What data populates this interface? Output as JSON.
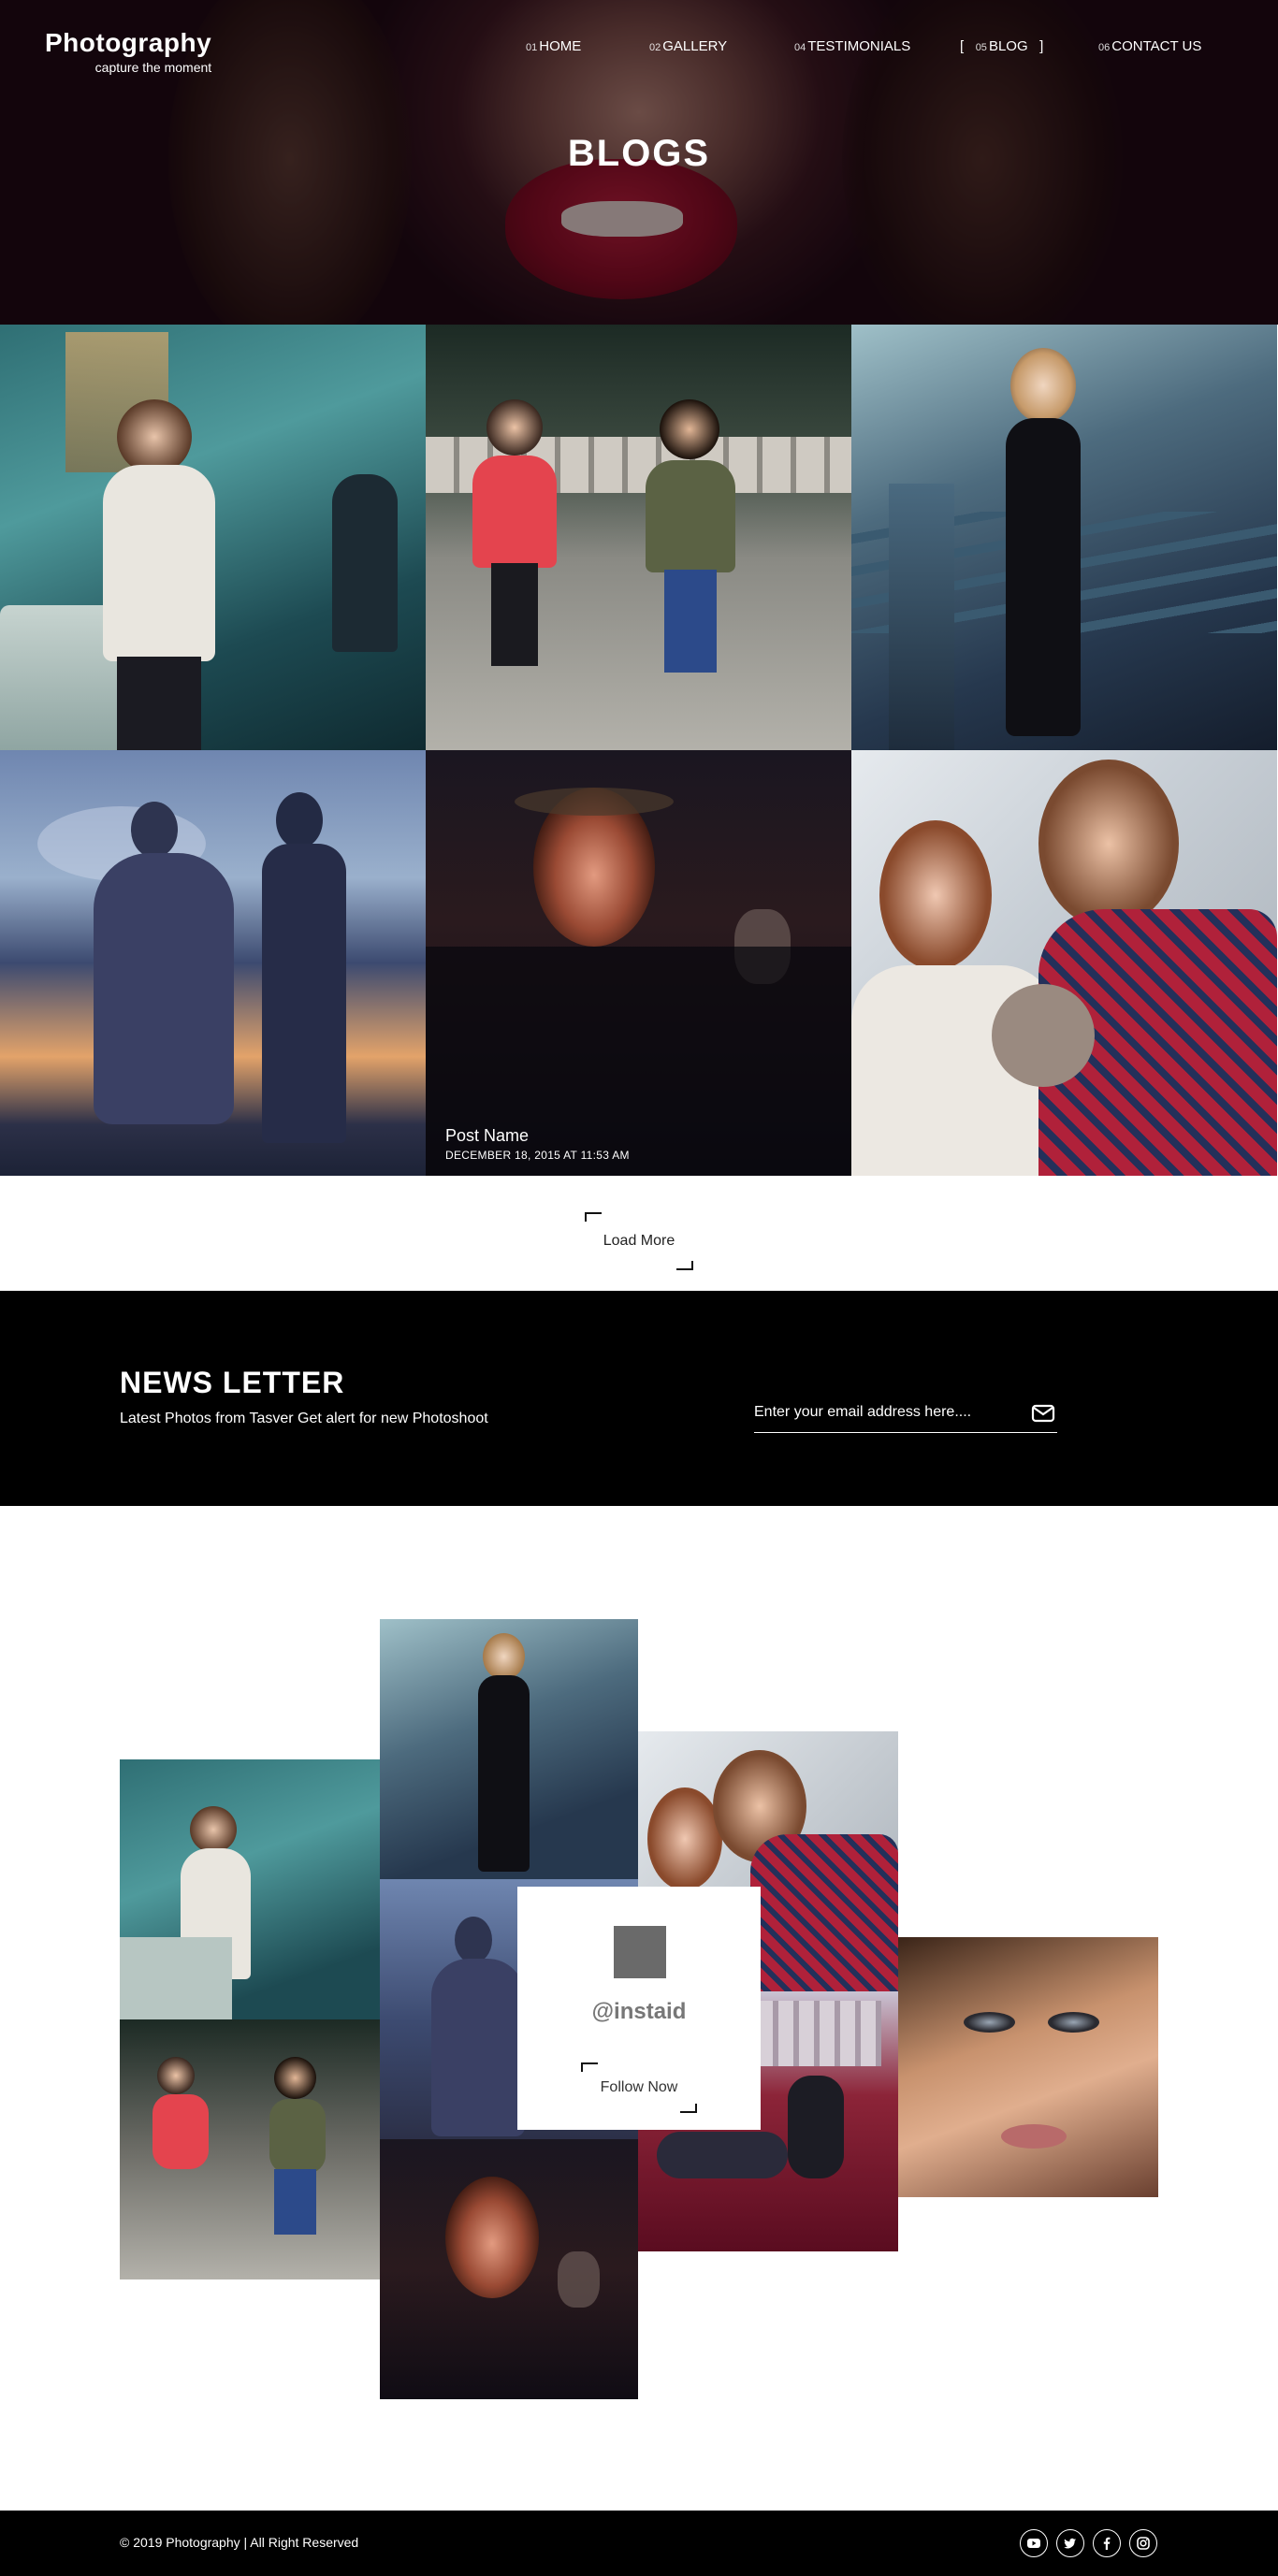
{
  "brand": {
    "title": "Photography",
    "tagline": "capture the moment"
  },
  "nav": [
    {
      "num": "01",
      "label": "HOME",
      "active": false
    },
    {
      "num": "02",
      "label": "GALLERY",
      "active": false
    },
    {
      "num": "04",
      "label": "TESTIMONIALS",
      "active": false
    },
    {
      "num": "05",
      "label": "BLOG",
      "active": true
    },
    {
      "num": "06",
      "label": "CONTACT US",
      "active": false
    }
  ],
  "nav_active_brackets": {
    "open": "[",
    "close": "]"
  },
  "hero": {
    "title": "BLOGS"
  },
  "gallery": {
    "post": {
      "name": "Post Name",
      "date": "DECEMBER 18, 2015 AT 11:53 AM"
    },
    "load_more": "Load More"
  },
  "newsletter": {
    "title": "NEWS LETTER",
    "subtitle": "Latest Photos from Tasver Get alert for new Photoshoot",
    "email_placeholder": "Enter your email address here....",
    "send_icon": "envelope-icon"
  },
  "instagram": {
    "handle": "@instaid",
    "follow_label": "Follow Now"
  },
  "footer": {
    "copyright": "© 2019 Photography | All Right Reserved",
    "social": [
      "youtube-icon",
      "twitter-icon",
      "facebook-icon",
      "instagram-icon"
    ]
  },
  "colors": {
    "background": "#ffffff",
    "dark": "#000000",
    "accent": "#ffffff"
  }
}
